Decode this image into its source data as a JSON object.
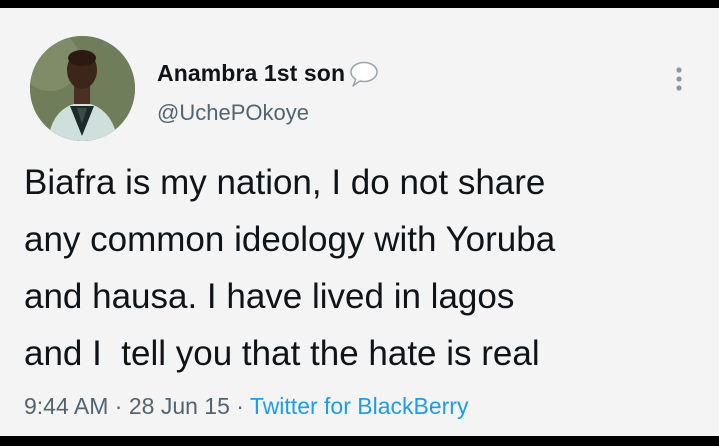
{
  "tweet": {
    "display_name": "Anambra 1st son",
    "name_emoji_icon": "speech-balloon-icon",
    "handle": "@UchePOkoye",
    "more_icon": "more-vertical-icon",
    "text_lines": [
      "Biafra is my nation, I do not share",
      "any common ideology with Yoruba",
      "and hausa. I have lived in lagos",
      "and I  tell you that the hate is real"
    ],
    "time": "9:44 AM",
    "separator": "·",
    "date": "28 Jun 15",
    "source": "Twitter for BlackBerry"
  },
  "colors": {
    "text": "#0f1419",
    "secondary": "#536471",
    "link": "#1d9bf0",
    "background": "#f4f4f4",
    "frame": "#000000"
  }
}
